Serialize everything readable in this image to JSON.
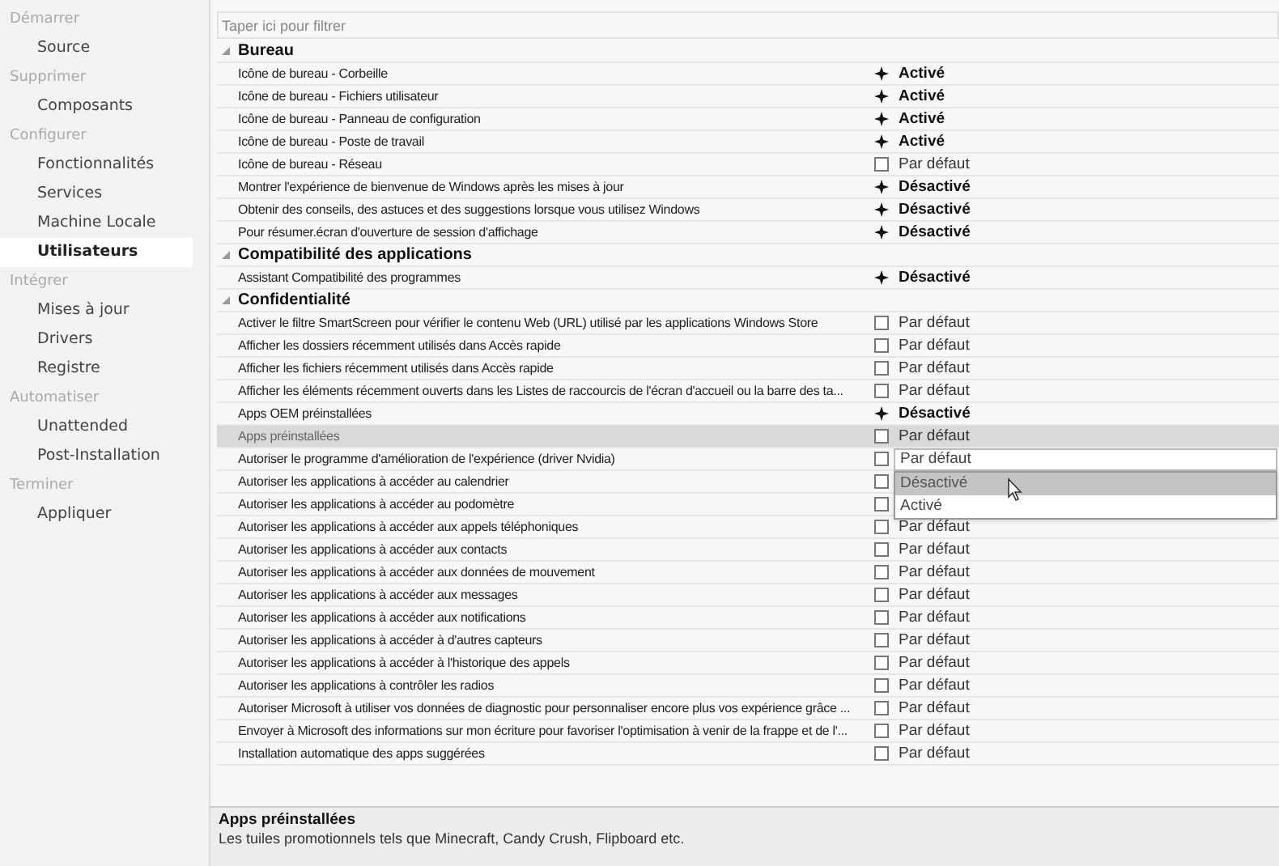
{
  "sidebar": {
    "groups": [
      {
        "title": "Démarrer",
        "items": [
          {
            "label": "Source",
            "selected": false
          }
        ]
      },
      {
        "title": "Supprimer",
        "items": [
          {
            "label": "Composants",
            "selected": false
          }
        ]
      },
      {
        "title": "Configurer",
        "items": [
          {
            "label": "Fonctionnalités",
            "selected": false
          },
          {
            "label": "Services",
            "selected": false
          },
          {
            "label": "Machine Locale",
            "selected": false
          },
          {
            "label": "Utilisateurs",
            "selected": true
          }
        ]
      },
      {
        "title": "Intégrer",
        "items": [
          {
            "label": "Mises à jour",
            "selected": false
          },
          {
            "label": "Drivers",
            "selected": false
          },
          {
            "label": "Registre",
            "selected": false
          }
        ]
      },
      {
        "title": "Automatiser",
        "items": [
          {
            "label": "Unattended",
            "selected": false
          },
          {
            "label": "Post-Installation",
            "selected": false
          }
        ]
      },
      {
        "title": "Terminer",
        "items": [
          {
            "label": "Appliquer",
            "selected": false
          }
        ]
      }
    ]
  },
  "filter": {
    "placeholder": "Taper ici pour filtrer"
  },
  "groups": [
    {
      "title": "Bureau",
      "expanded": true,
      "items": [
        {
          "label": "Icône de bureau - Corbeille",
          "kind": "set",
          "value": "Activé",
          "selected": false
        },
        {
          "label": "Icône de bureau - Fichiers utilisateur",
          "kind": "set",
          "value": "Activé",
          "selected": false
        },
        {
          "label": "Icône de bureau - Panneau de configuration",
          "kind": "set",
          "value": "Activé",
          "selected": false
        },
        {
          "label": "Icône de bureau - Poste de travail",
          "kind": "set",
          "value": "Activé",
          "selected": false
        },
        {
          "label": "Icône de bureau - Réseau",
          "kind": "default",
          "value": "Par défaut",
          "selected": false
        },
        {
          "label": "Montrer l'expérience de bienvenue de Windows après les mises à jour",
          "kind": "set",
          "value": "Désactivé",
          "selected": false
        },
        {
          "label": "Obtenir des conseils, des astuces et des suggestions lorsque vous utilisez Windows",
          "kind": "set",
          "value": "Désactivé",
          "selected": false
        },
        {
          "label": "Pour résumer.écran d'ouverture de session d'affichage",
          "kind": "set",
          "value": "Désactivé",
          "selected": false
        }
      ]
    },
    {
      "title": "Compatibilité des applications",
      "expanded": true,
      "items": [
        {
          "label": "Assistant Compatibilité des programmes",
          "kind": "set",
          "value": "Désactivé",
          "selected": false
        }
      ]
    },
    {
      "title": "Confidentialité",
      "expanded": true,
      "items": [
        {
          "label": "Activer le filtre SmartScreen pour vérifier le contenu Web (URL) utilisé par les applications Windows Store",
          "kind": "default",
          "value": "Par défaut",
          "selected": false
        },
        {
          "label": "Afficher les dossiers récemment utilisés dans Accès rapide",
          "kind": "default",
          "value": "Par défaut",
          "selected": false
        },
        {
          "label": "Afficher les fichiers récemment utilisés dans Accès rapide",
          "kind": "default",
          "value": "Par défaut",
          "selected": false
        },
        {
          "label": "Afficher les éléments récemment ouverts dans les Listes de raccourcis de l'écran d'accueil ou la barre des ta...",
          "kind": "default",
          "value": "Par défaut",
          "selected": false
        },
        {
          "label": "Apps OEM préinstallées",
          "kind": "set",
          "value": "Désactivé",
          "selected": false
        },
        {
          "label": "Apps préinstallées",
          "kind": "default",
          "value": "Par défaut",
          "selected": true
        },
        {
          "label": "Autoriser le programme d'amélioration de l'expérience (driver Nvidia)",
          "kind": "default",
          "value": "Par défaut",
          "selected": false,
          "dropdown": {
            "options": [
              {
                "label": "Désactivé",
                "selected": true
              },
              {
                "label": "Activé",
                "selected": false
              }
            ]
          }
        },
        {
          "label": "Autoriser les applications à accéder au calendrier",
          "kind": "default",
          "selected": false
        },
        {
          "label": "Autoriser les applications à accéder au podomètre",
          "kind": "default",
          "selected": false
        },
        {
          "label": "Autoriser les applications à accéder aux appels téléphoniques",
          "kind": "default",
          "value": "Par défaut",
          "selected": false
        },
        {
          "label": "Autoriser les applications à accéder aux contacts",
          "kind": "default",
          "value": "Par défaut",
          "selected": false
        },
        {
          "label": "Autoriser les applications à accéder aux données de mouvement",
          "kind": "default",
          "value": "Par défaut",
          "selected": false
        },
        {
          "label": "Autoriser les applications à accéder aux messages",
          "kind": "default",
          "value": "Par défaut",
          "selected": false
        },
        {
          "label": "Autoriser les applications à accéder aux notifications",
          "kind": "default",
          "value": "Par défaut",
          "selected": false
        },
        {
          "label": "Autoriser les applications à accéder à d'autres capteurs",
          "kind": "default",
          "value": "Par défaut",
          "selected": false
        },
        {
          "label": "Autoriser les applications à accéder à l'historique des appels",
          "kind": "default",
          "value": "Par défaut",
          "selected": false
        },
        {
          "label": "Autoriser les applications à contrôler les radios",
          "kind": "default",
          "value": "Par défaut",
          "selected": false
        },
        {
          "label": "Autoriser Microsoft à utiliser vos données de diagnostic pour personnaliser encore plus vos expérience grâce ...",
          "kind": "default",
          "value": "Par défaut",
          "selected": false
        },
        {
          "label": "Envoyer à Microsoft des informations sur mon écriture pour favoriser l'optimisation à venir de la frappe et de l'...",
          "kind": "default",
          "value": "Par défaut",
          "selected": false
        },
        {
          "label": "Installation automatique des apps suggérées",
          "kind": "default",
          "value": "Par défaut",
          "selected": false
        }
      ]
    }
  ],
  "details": {
    "title": "Apps préinstallées",
    "description": "Les tuiles promotionnels tels que Minecraft, Candy Crush, Flipboard etc."
  }
}
